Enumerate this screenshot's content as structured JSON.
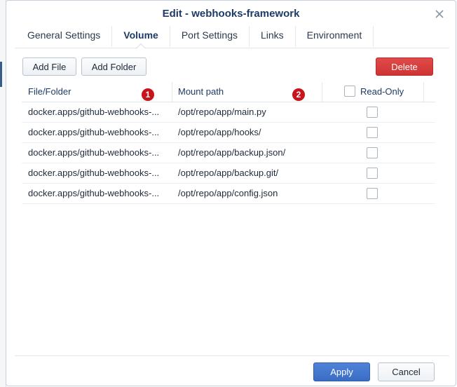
{
  "dialog": {
    "title": "Edit - webhooks-framework",
    "close_icon": "close-icon"
  },
  "tabs": [
    {
      "label": "General Settings",
      "active": false
    },
    {
      "label": "Volume",
      "active": true
    },
    {
      "label": "Port Settings",
      "active": false
    },
    {
      "label": "Links",
      "active": false
    },
    {
      "label": "Environment",
      "active": false
    }
  ],
  "toolbar": {
    "add_file": "Add File",
    "add_folder": "Add Folder",
    "delete": "Delete"
  },
  "table": {
    "columns": [
      "File/Folder",
      "Mount path",
      "Read-Only"
    ],
    "rows": [
      {
        "file": "docker.apps/github-webhooks-...",
        "mount": "/opt/repo/app/main.py",
        "read_only": false
      },
      {
        "file": "docker.apps/github-webhooks-...",
        "mount": "/opt/repo/app/hooks/",
        "read_only": false
      },
      {
        "file": "docker.apps/github-webhooks-...",
        "mount": "/opt/repo/app/backup.json/",
        "read_only": false
      },
      {
        "file": "docker.apps/github-webhooks-...",
        "mount": "/opt/repo/app/backup.git/",
        "read_only": false
      },
      {
        "file": "docker.apps/github-webhooks-...",
        "mount": "/opt/repo/app/config.json",
        "read_only": false
      }
    ]
  },
  "markers": [
    "1",
    "2"
  ],
  "footer": {
    "apply": "Apply",
    "cancel": "Cancel"
  },
  "colors": {
    "title": "#1e3a66",
    "delete": "#d63a3a",
    "apply": "#4176d0",
    "marker": "#c8141b"
  }
}
